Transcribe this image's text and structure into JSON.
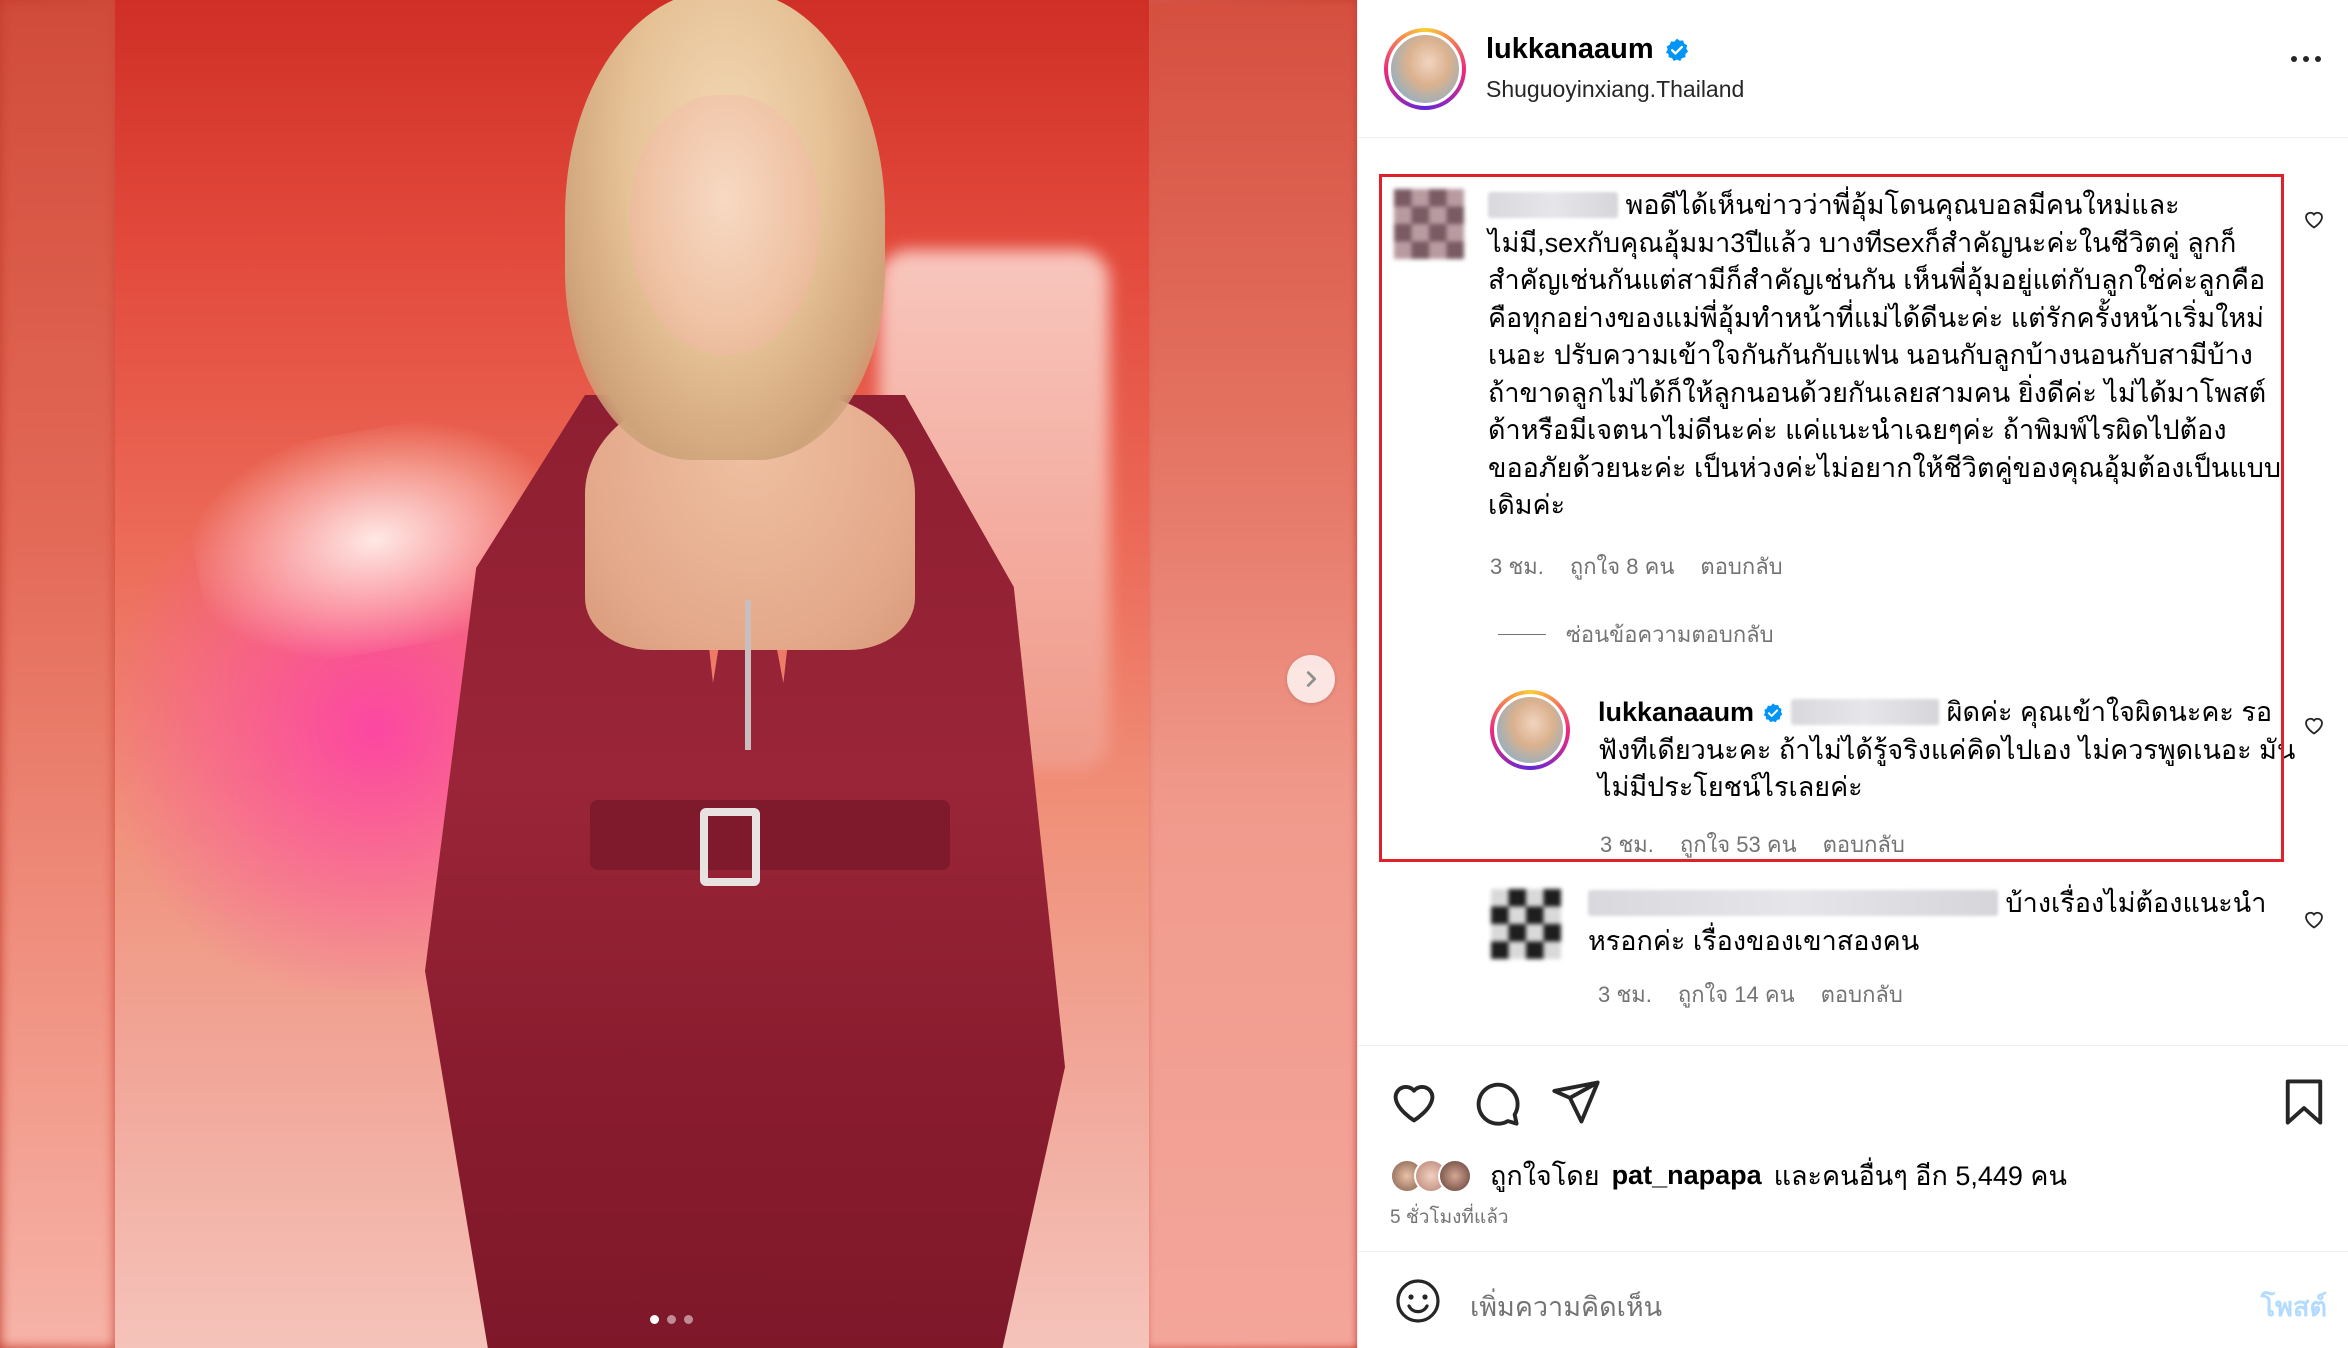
{
  "post": {
    "username": "lukkanaaum",
    "location": "Shuguoyinxiang.Thailand",
    "carousel": {
      "current": 1,
      "total": 3
    }
  },
  "comments": [
    {
      "text": "พอดีได้เห็นข่าวว่าพี่อุ้มโดนคุณบอลมีคนใหม่และไม่มี,sexกับคุณอุ้มมา3ปีแล้ว บางทีsexก็สำคัญนะค่ะในชีวิตคู่ ลูกก็สำคัญเช่นกันแต่สามีก็สำคัญเช่นกัน เห็นพี่อุ้มอยู่แต่กับลูกใช่ค่ะลูกคือคือทุกอย่างของแม่พี่อุ้มทำหน้าที่แม่ได้ดีนะค่ะ แต่รักครั้งหน้าเริ่มใหม่เนอะ ปรับความเข้าใจกันกันกับแฟน นอนกับลูกบ้างนอนกับสามีบ้าง ถ้าขาดลูกไม่ได้ก็ให้ลูกนอนด้วยกันเลยสามคน ยิ่งดีค่ะ ไม่ได้มาโพสต์ด้าหรือมีเจตนาไม่ดีนะค่ะ แค่แนะนำเฉยๆค่ะ ถ้าพิมพ์ไรผิดไปต้องขออภัยด้วยนะค่ะ เป็นห่วงค่ะไม่อยากให้ชีวิตคู่ของคุณอุ้มต้องเป็นแบบเดิมค่ะ",
      "time": "3 ชม.",
      "likes": "ถูกใจ 8 คน",
      "reply_label": "ตอบกลับ"
    },
    {
      "text": "บ้างเรื่องไม่ต้องแนะนำหรอกค่ะ เรื่องของเขาสองคน",
      "time": "3 ชม.",
      "likes": "ถูกใจ 14 คน",
      "reply_label": "ตอบกลับ"
    }
  ],
  "hide_replies_label": "ซ่อนข้อความตอบกลับ",
  "reply": {
    "username": "lukkanaaum",
    "text": "ผิดค่ะ คุณเข้าใจผิดนะคะ รอฟังทีเดียวนะคะ ถ้าไม่ได้รู้จริงแค่คิดไปเอง ไม่ควรพูดเนอะ มันไม่มีประโยชน์ไรเลยค่ะ",
    "time": "3 ชม.",
    "likes": "ถูกใจ 53 คน",
    "reply_label": "ตอบกลับ"
  },
  "liked_by": {
    "prefix": "ถูกใจโดย",
    "user": "pat_napapa",
    "suffix": "และคนอื่นๆ อีก 5,449 คน"
  },
  "time_ago": "5 ชั่วโมงที่แล้ว",
  "add_comment": {
    "placeholder": "เพิ่มความคิดเห็น",
    "post_label": "โพสต์"
  },
  "colors": {
    "highlight": "#e0212a",
    "verified": "#0095f6",
    "muted": "#737373",
    "post_btn": "#b3dbff"
  },
  "icons": [
    "heart-icon",
    "comment-icon",
    "share-icon",
    "bookmark-icon",
    "emoji-icon",
    "verified-icon",
    "more-icon",
    "chevron-right-icon"
  ]
}
